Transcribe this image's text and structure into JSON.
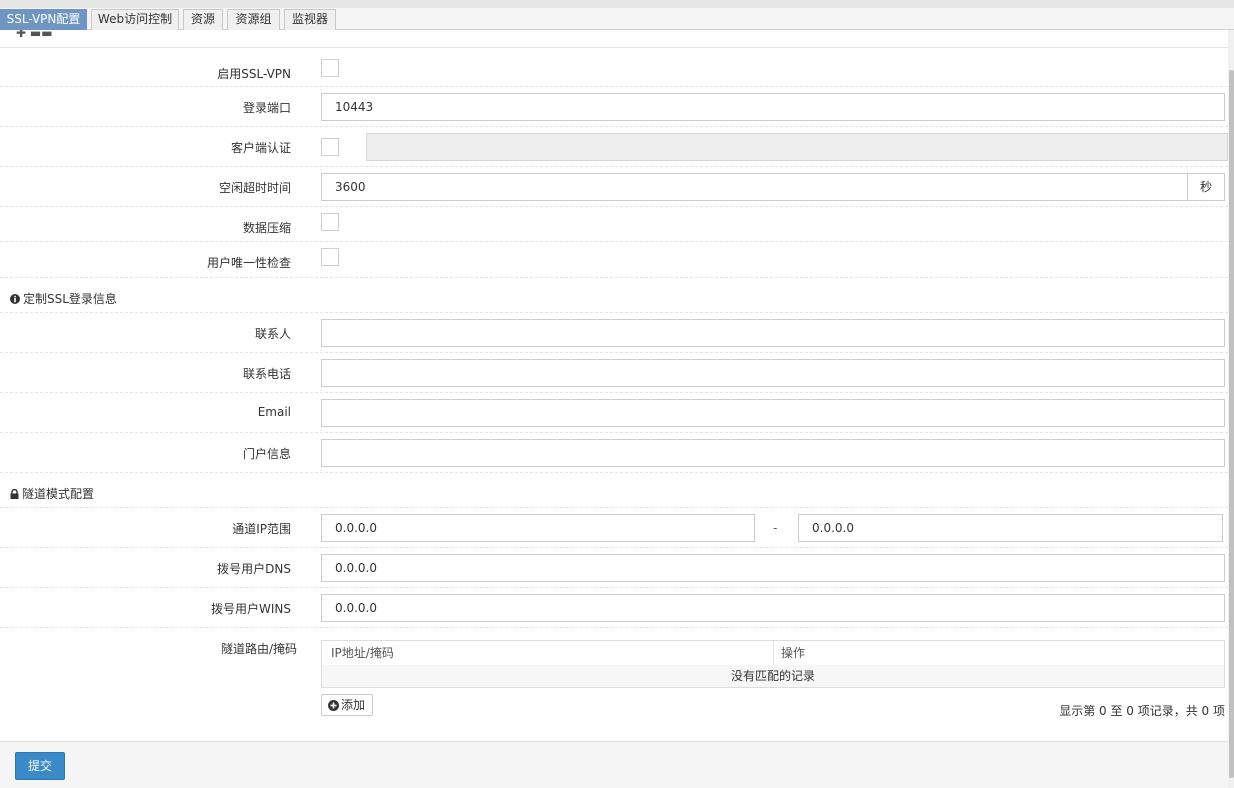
{
  "tabs": [
    "SSL-VPN配置",
    "Web访问控制",
    "资源",
    "资源组",
    "监视器"
  ],
  "form": {
    "enable_label": "启用SSL-VPN",
    "port_label": "登录端口",
    "port_value": "10443",
    "client_auth_label": "客户端认证",
    "idle_timeout_label": "空闲超时时间",
    "idle_timeout_value": "3600",
    "idle_timeout_unit": "秒",
    "compression_label": "数据压缩",
    "unique_check_label": "用户唯一性检查"
  },
  "login_info": {
    "section_title": "定制SSL登录信息",
    "contact_label": "联系人",
    "phone_label": "联系电话",
    "email_label": "Email",
    "portal_label": "门户信息"
  },
  "tunnel": {
    "section_title": "隧道模式配置",
    "ip_range_label": "通道IP范围",
    "ip_start": "0.0.0.0",
    "ip_separator": "-",
    "ip_end": "0.0.0.0",
    "dns_label": "拨号用户DNS",
    "dns_value": "0.0.0.0",
    "wins_label": "拨号用户WINS",
    "wins_value": "0.0.0.0",
    "routes_label": "隧道路由/掩码",
    "table_headers": [
      "IP地址/掩码",
      "操作"
    ],
    "empty_text": "没有匹配的记录",
    "add_label": "添加",
    "page_info": "显示第 0 至 0 项记录，共 0 项"
  },
  "submit_label": "提交",
  "colors": {
    "accent": "#3a8ac8",
    "active_tab": "#6f96c3"
  },
  "icons": {
    "info": "info-circle-icon",
    "lock": "lock-icon",
    "add": "plus-circle-icon"
  }
}
